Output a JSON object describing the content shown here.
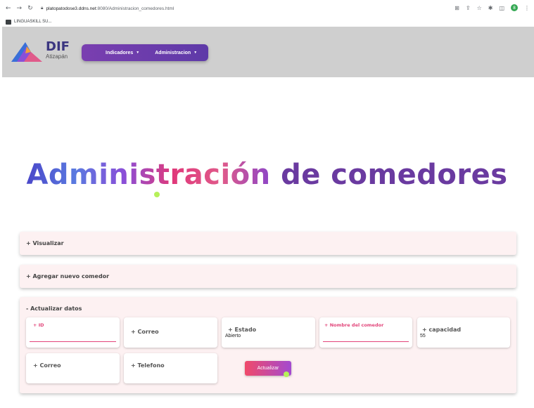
{
  "browser": {
    "url_host": "platopatodose3.ddns.net",
    "url_path": ":8080/Administracion_comedores.html",
    "bookmark": "LINGUASKILL SU..."
  },
  "header": {
    "logo_title": "DIF",
    "logo_subtitle": "Atizapán",
    "nav": [
      "Indicadores",
      "Administracion"
    ]
  },
  "hero": {
    "title_part1": "Administración",
    "title_part2": "de comedores"
  },
  "accordions": {
    "visualizar": "+ Visualizar",
    "agregar": "+ Agregar nuevo comedor",
    "actualizar": "- Actualizar datos"
  },
  "form": {
    "id_label": "+ ID",
    "correo_label": "+ Correo",
    "estado_label": "+ Estado",
    "estado_value": "Abierto",
    "nombre_label": "+ Nombre del comedor",
    "capacidad_label": "+ capacidad",
    "capacidad_value": "55",
    "correo2_label": "+ Correo",
    "telefono_label": "+ Telefono",
    "submit": "Actualizar"
  }
}
